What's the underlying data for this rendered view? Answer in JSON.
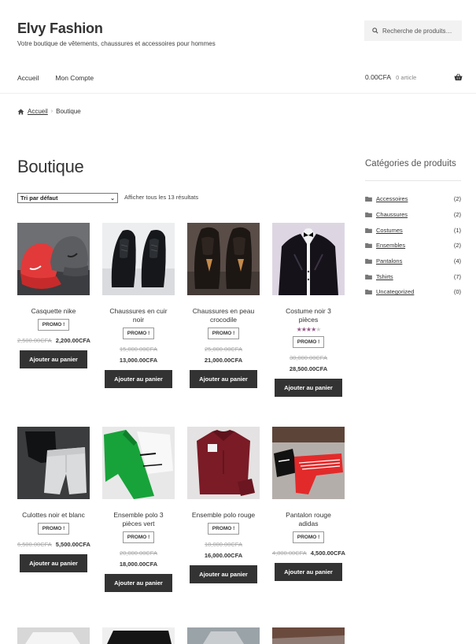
{
  "site": {
    "title": "Elvy Fashion",
    "description": "Votre boutique de vêtements, chaussures et accessoires pour hommes"
  },
  "search": {
    "placeholder": "Recherche de produits…"
  },
  "nav": {
    "items": [
      "Accueil",
      "Mon Compte"
    ]
  },
  "cart": {
    "amount": "0.00CFA",
    "count": "0 article",
    "icon": "basket-icon"
  },
  "breadcrumb": {
    "home": "Accueil",
    "current": "Boutique"
  },
  "page": {
    "title": "Boutique",
    "sort_selected": "Tri par défaut",
    "result_count": "Afficher tous les 13 résultats"
  },
  "products": [
    {
      "name": "Casquette nike",
      "badge": "PROMO !",
      "old_price": "2,500.00CFA",
      "new_price": "2,200.00CFA",
      "button": "Ajouter au panier"
    },
    {
      "name": "Chaussures en cuir noir",
      "badge": "PROMO !",
      "old_price": "15,000.00CFA",
      "new_price": "13,000.00CFA",
      "button": "Ajouter au panier"
    },
    {
      "name": "Chaussures en peau crocodile",
      "badge": "PROMO !",
      "old_price": "25,000.00CFA",
      "new_price": "21,000.00CFA",
      "button": "Ajouter au panier"
    },
    {
      "name": "Costume noir 3 pièces",
      "rating": 4,
      "rating_max": 5,
      "badge": "PROMO !",
      "old_price": "30,000.00CFA",
      "new_price": "28,500.00CFA",
      "button": "Ajouter au panier"
    },
    {
      "name": "Culottes noir et blanc",
      "badge": "PROMO !",
      "old_price": "6,500.00CFA",
      "new_price": "5,500.00CFA",
      "button": "Ajouter au panier"
    },
    {
      "name": "Ensemble polo 3 pièces vert",
      "badge": "PROMO !",
      "old_price": "20,000.00CFA",
      "new_price": "18,000.00CFA",
      "button": "Ajouter au panier"
    },
    {
      "name": "Ensemble polo rouge",
      "badge": "PROMO !",
      "old_price": "18,000.00CFA",
      "new_price": "16,000.00CFA",
      "button": "Ajouter au panier"
    },
    {
      "name": "Pantalon rouge adidas",
      "badge": "PROMO !",
      "old_price": "4,800.00CFA",
      "new_price": "4,500.00CFA",
      "button": "Ajouter au panier"
    }
  ],
  "sidebar": {
    "title": "Catégories de produits",
    "categories": [
      {
        "name": "Accessoires",
        "count": "(2)"
      },
      {
        "name": "Chaussures",
        "count": "(2)"
      },
      {
        "name": "Costumes",
        "count": "(1)"
      },
      {
        "name": "Ensembles",
        "count": "(2)"
      },
      {
        "name": "Pantalons",
        "count": "(4)"
      },
      {
        "name": "Tshirts",
        "count": "(7)"
      },
      {
        "name": "Uncategorized",
        "count": "(0)"
      }
    ]
  },
  "colors": {
    "button": "#333333",
    "rating": "#96588a",
    "search_bg": "#f2f2f2"
  }
}
